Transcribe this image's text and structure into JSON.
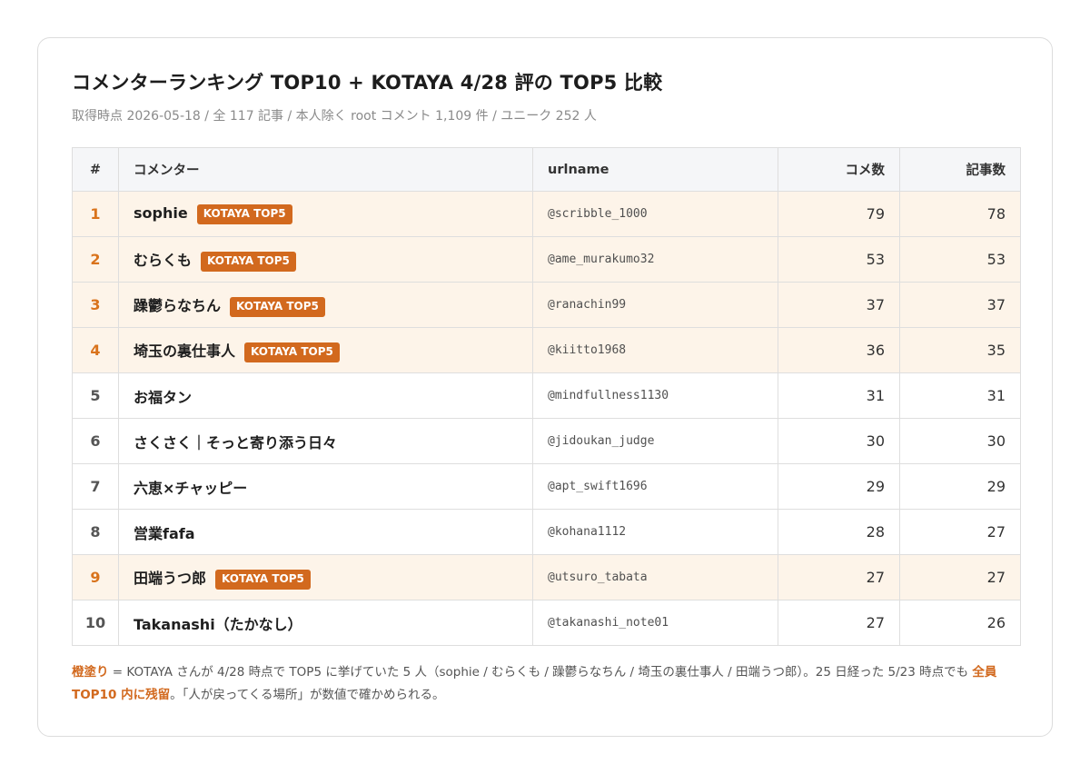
{
  "header": {
    "title": "コメンターランキング TOP10 + KOTAYA 4/28 評の TOP5 比較",
    "subtitle": "取得時点 2026-05-18 / 全 117 記事 / 本人除く root コメント 1,109 件 / ユニーク 252 人"
  },
  "table": {
    "columns": [
      "#",
      "コメンター",
      "urlname",
      "コメ数",
      "記事数"
    ],
    "badge_label": "KOTAYA TOP5",
    "rows": [
      {
        "rank": "1",
        "name": "sophie",
        "urlname": "@scribble_1000",
        "comments": "79",
        "articles": "78",
        "top5": true
      },
      {
        "rank": "2",
        "name": "むらくも",
        "urlname": "@ame_murakumo32",
        "comments": "53",
        "articles": "53",
        "top5": true
      },
      {
        "rank": "3",
        "name": "躁鬱らなちん",
        "urlname": "@ranachin99",
        "comments": "37",
        "articles": "37",
        "top5": true
      },
      {
        "rank": "4",
        "name": "埼玉の裏仕事人",
        "urlname": "@kiitto1968",
        "comments": "36",
        "articles": "35",
        "top5": true
      },
      {
        "rank": "5",
        "name": "お福タン",
        "urlname": "@mindfullness1130",
        "comments": "31",
        "articles": "31",
        "top5": false
      },
      {
        "rank": "6",
        "name": "さくさく｜そっと寄り添う日々",
        "urlname": "@jidoukan_judge",
        "comments": "30",
        "articles": "30",
        "top5": false
      },
      {
        "rank": "7",
        "name": "六恵×チャッピー",
        "urlname": "@apt_swift1696",
        "comments": "29",
        "articles": "29",
        "top5": false
      },
      {
        "rank": "8",
        "name": "営業fafa",
        "urlname": "@kohana1112",
        "comments": "28",
        "articles": "27",
        "top5": false
      },
      {
        "rank": "9",
        "name": "田端うつ郎",
        "urlname": "@utsuro_tabata",
        "comments": "27",
        "articles": "27",
        "top5": true
      },
      {
        "rank": "10",
        "name": "Takanashi（たかなし）",
        "urlname": "@takanashi_note01",
        "comments": "27",
        "articles": "26",
        "top5": false
      }
    ]
  },
  "note": {
    "lead": "橙塗り",
    "part1": " = KOTAYA さんが 4/28 時点で TOP5 に挙げていた 5 人（sophie / むらくも / 躁鬱らなちん / 埼玉の裏仕事人 / 田端うつ郎）。25 日経った 5/23 時点でも ",
    "emphasis": "全員 TOP10 内に残留",
    "part2": "。「人が戻ってくる場所」が数値で確かめられる。"
  },
  "colors": {
    "accent": "#d2691e",
    "highlight_row": "#fdf4e9",
    "header_bg": "#f5f6f8"
  }
}
